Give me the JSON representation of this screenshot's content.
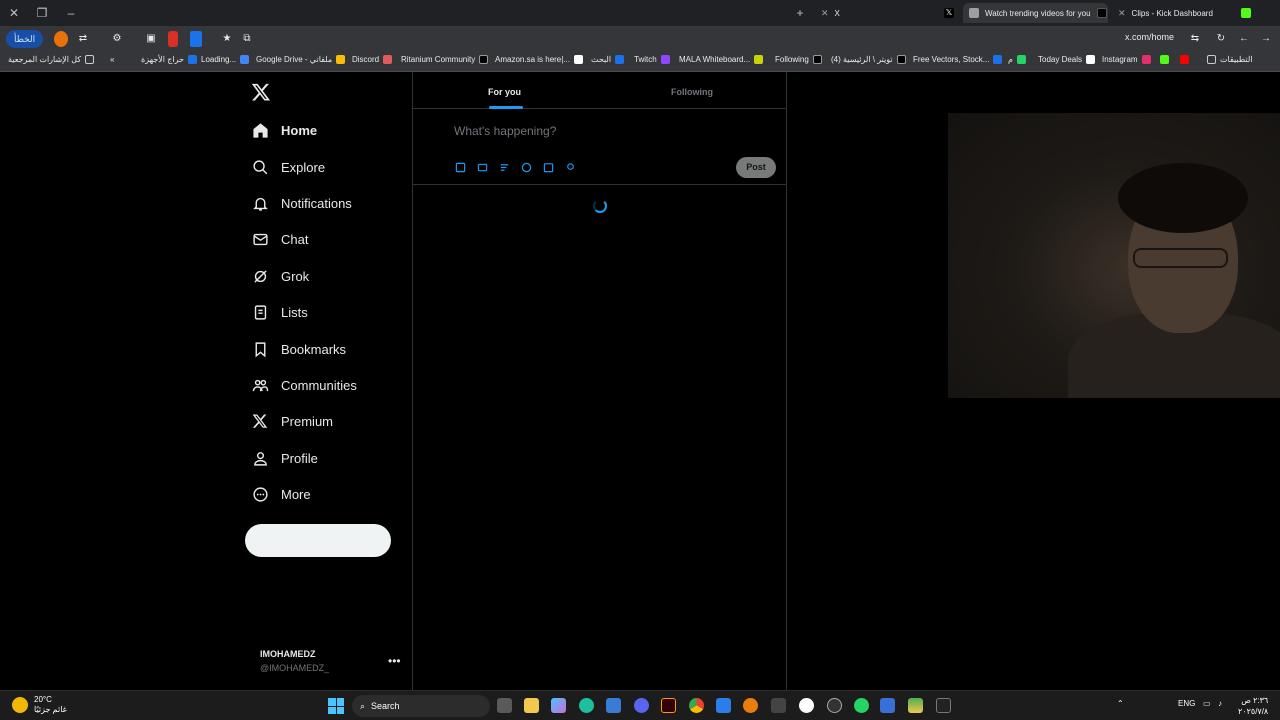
{
  "browser": {
    "tabs": [
      {
        "title": "X",
        "active": false
      },
      {
        "title": "Watch trending videos for you",
        "active": true
      },
      {
        "title": "Clips - Kick Dashboard",
        "active": false
      }
    ],
    "error_pill": "الخطأ",
    "address": "x.com/home",
    "bookmarks_all": "كل الإشارات المرجعية",
    "bookmarks": [
      "حراج الأجهزة",
      "Loading...",
      "Google Drive - ملفاتي",
      "Discord",
      "Ritanium Community",
      "Amazon.sa is here|...",
      "البحث",
      "Twitch",
      "MALA Whiteboard...",
      "Following",
      "(4) تويتر \\ الرئيسية",
      "Free Vectors, Stock...",
      "م",
      "Today Deals",
      "Instagram",
      "التطبيقات"
    ]
  },
  "sidebar": {
    "items": [
      {
        "label": "Home",
        "icon": "home-icon"
      },
      {
        "label": "Explore",
        "icon": "search-icon"
      },
      {
        "label": "Notifications",
        "icon": "bell-icon"
      },
      {
        "label": "Chat",
        "icon": "mail-icon"
      },
      {
        "label": "Grok",
        "icon": "grok-icon"
      },
      {
        "label": "Lists",
        "icon": "list-icon"
      },
      {
        "label": "Bookmarks",
        "icon": "bookmark-icon"
      },
      {
        "label": "Communities",
        "icon": "people-icon"
      },
      {
        "label": "Premium",
        "icon": "x-icon"
      },
      {
        "label": "Profile",
        "icon": "person-icon"
      },
      {
        "label": "More",
        "icon": "more-circle-icon"
      }
    ],
    "account": {
      "name": "IMOHAMEDZ",
      "handle": "@IMOHAMEDZ_"
    }
  },
  "feed": {
    "tab_for_you": "For you",
    "tab_following": "Following",
    "compose_placeholder": "What's happening?",
    "post_label": "Post"
  },
  "taskbar": {
    "temperature": "20°C",
    "weather_text": "غائم جزئيًا",
    "search": "Search",
    "language": "ENG",
    "time": "٢:٣٦ ص",
    "date": "٢٠٢٥/٧/٨"
  },
  "colors": {
    "accent": "#1d9bf0",
    "background": "#000000",
    "text": "#e7e9ea",
    "muted": "#71767b"
  }
}
